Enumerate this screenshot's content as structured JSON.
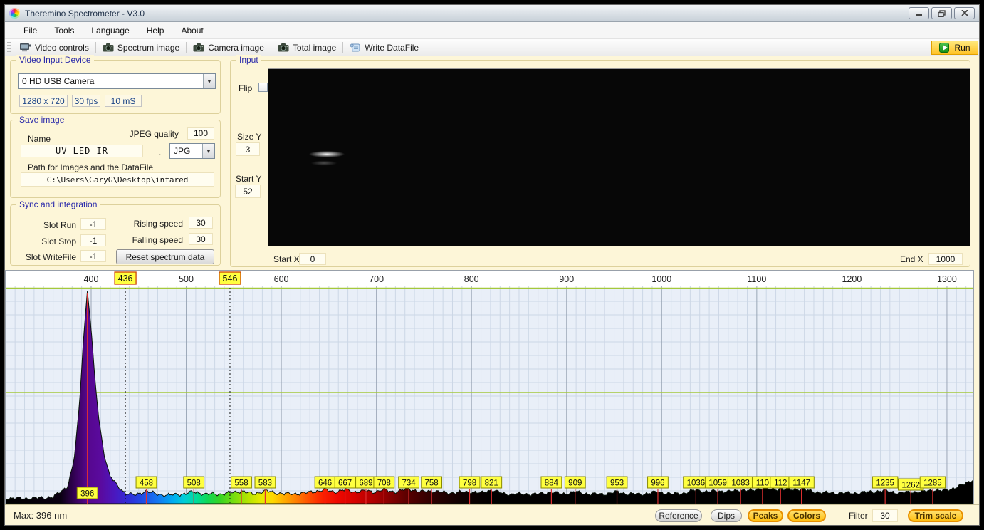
{
  "window": {
    "title": "Theremino Spectrometer - V3.0"
  },
  "menu": {
    "items": [
      "File",
      "Tools",
      "Language",
      "Help",
      "About"
    ]
  },
  "toolbar": {
    "items": [
      {
        "label": "Video controls",
        "icon": "video-controls-icon"
      },
      {
        "label": "Spectrum image",
        "icon": "camera-icon"
      },
      {
        "label": "Camera image",
        "icon": "camera-icon"
      },
      {
        "label": "Total image",
        "icon": "camera-icon"
      },
      {
        "label": "Write DataFile",
        "icon": "scroll-icon"
      }
    ],
    "run_label": "Run"
  },
  "video_input": {
    "group_title": "Video Input Device",
    "device": "0 HD USB Camera",
    "resolution": "1280 x 720",
    "fps": "30 fps",
    "exposure": "10 mS"
  },
  "save_image": {
    "group_title": "Save image",
    "name_label": "Name",
    "jpeg_quality_label": "JPEG quality",
    "jpeg_quality": "100",
    "name_value": "UV LED IR",
    "dot": ".",
    "format": "JPG",
    "path_label": "Path for Images and the DataFile",
    "path": "C:\\Users\\GaryG\\Desktop\\infared"
  },
  "sync": {
    "group_title": "Sync and integration",
    "slot_run_label": "Slot Run",
    "slot_run": "-1",
    "slot_stop_label": "Slot Stop",
    "slot_stop": "-1",
    "slot_writefile_label": "Slot WriteFile",
    "slot_writefile": "-1",
    "rising_label": "Rising speed",
    "rising": "30",
    "falling_label": "Falling speed",
    "falling": "30",
    "reset_button": "Reset spectrum data"
  },
  "input_panel": {
    "group_title": "Input",
    "flip_label": "Flip",
    "size_y_label": "Size Y",
    "size_y": "3",
    "start_y_label": "Start Y",
    "start_y": "52",
    "start_x_label": "Start X",
    "start_x": "0",
    "end_x_label": "End X",
    "end_x": "1000"
  },
  "status_bar": {
    "max_label": "Max: 396 nm",
    "reference": "Reference",
    "dips": "Dips",
    "peaks": "Peaks",
    "colors": "Colors",
    "filter_label": "Filter",
    "filter_value": "30",
    "trim": "Trim scale"
  },
  "colors": {
    "accent_yellow": "#ffd34d",
    "accent_orange_border": "#e08a00",
    "group_title_blue": "#2929aa",
    "run_green": "#1fa01f",
    "peak_line_red": "#e03030",
    "label_yellow": "#ffff40",
    "label_border": "#8a8a00",
    "calibration_border": "#cc4400",
    "grid_minor": "#ccd7e6",
    "grid_major": "#9aa6b6",
    "grid_green": "#a4c83c",
    "chart_bg": "#e9eff8",
    "strip_bg": "#ffffff",
    "curve_stroke": "#0a140a"
  },
  "chart_data": {
    "type": "area",
    "description": "Emission spectrum, intensity vs wavelength (nm)",
    "x_ticks": [
      400,
      500,
      600,
      700,
      800,
      900,
      1000,
      1100,
      1200,
      1300
    ],
    "x_range_nm": [
      309,
      1334
    ],
    "grid": true,
    "calibration_lines_nm": [
      436,
      546
    ],
    "max_peak_nm": 396,
    "peaks": [
      {
        "label": "396",
        "nm": 396,
        "tall_line": true,
        "dy": 15
      },
      {
        "label": "458",
        "nm": 458
      },
      {
        "label": "508",
        "nm": 508
      },
      {
        "label": "558",
        "nm": 558
      },
      {
        "label": "583",
        "nm": 583
      },
      {
        "label": "646",
        "nm": 646
      },
      {
        "label": "667",
        "nm": 667
      },
      {
        "label": "689",
        "nm": 689
      },
      {
        "label": "708",
        "nm": 708
      },
      {
        "label": "734",
        "nm": 734
      },
      {
        "label": "758",
        "nm": 758
      },
      {
        "label": "798",
        "nm": 798
      },
      {
        "label": "821",
        "nm": 821
      },
      {
        "label": "884",
        "nm": 884
      },
      {
        "label": "909",
        "nm": 909
      },
      {
        "label": "953",
        "nm": 953
      },
      {
        "label": "996",
        "nm": 996
      },
      {
        "label": "1036",
        "nm": 1036
      },
      {
        "label": "1059",
        "nm": 1059
      },
      {
        "label": "1083",
        "nm": 1083
      },
      {
        "label": "110",
        "nm": 1106
      },
      {
        "label": "112",
        "nm": 1125
      },
      {
        "label": "1147",
        "nm": 1147
      },
      {
        "label": "1235",
        "nm": 1235
      },
      {
        "label": "1262",
        "nm": 1262,
        "dy": 3
      },
      {
        "label": "1285",
        "nm": 1285
      }
    ],
    "profile_nm_intensity": [
      [
        309,
        2.5
      ],
      [
        340,
        2.5
      ],
      [
        360,
        3
      ],
      [
        375,
        8
      ],
      [
        382,
        20
      ],
      [
        388,
        48
      ],
      [
        392,
        78
      ],
      [
        396,
        100
      ],
      [
        400,
        82
      ],
      [
        404,
        58
      ],
      [
        408,
        40
      ],
      [
        414,
        22
      ],
      [
        420,
        13
      ],
      [
        428,
        8
      ],
      [
        436,
        5
      ],
      [
        446,
        4
      ],
      [
        458,
        6
      ],
      [
        468,
        4.5
      ],
      [
        480,
        4
      ],
      [
        495,
        4.5
      ],
      [
        508,
        5.5
      ],
      [
        520,
        4.5
      ],
      [
        535,
        4.5
      ],
      [
        546,
        5
      ],
      [
        558,
        6
      ],
      [
        570,
        4.5
      ],
      [
        583,
        6
      ],
      [
        595,
        5
      ],
      [
        610,
        4.5
      ],
      [
        625,
        5
      ],
      [
        646,
        6.5
      ],
      [
        656,
        5.5
      ],
      [
        667,
        6.5
      ],
      [
        678,
        5.5
      ],
      [
        689,
        6
      ],
      [
        698,
        5.5
      ],
      [
        708,
        6.5
      ],
      [
        720,
        5.5
      ],
      [
        734,
        7
      ],
      [
        746,
        5.5
      ],
      [
        758,
        6
      ],
      [
        775,
        5
      ],
      [
        798,
        5.5
      ],
      [
        810,
        5
      ],
      [
        821,
        6.5
      ],
      [
        835,
        4.5
      ],
      [
        850,
        4.5
      ],
      [
        870,
        4.5
      ],
      [
        884,
        5.5
      ],
      [
        895,
        4.5
      ],
      [
        909,
        5.5
      ],
      [
        925,
        4.5
      ],
      [
        940,
        4.5
      ],
      [
        953,
        5.5
      ],
      [
        965,
        4.5
      ],
      [
        980,
        4.5
      ],
      [
        996,
        5.5
      ],
      [
        1010,
        4.5
      ],
      [
        1025,
        5
      ],
      [
        1036,
        6.5
      ],
      [
        1048,
        5.5
      ],
      [
        1059,
        6
      ],
      [
        1070,
        5.5
      ],
      [
        1083,
        6.5
      ],
      [
        1095,
        6
      ],
      [
        1106,
        7.5
      ],
      [
        1116,
        6.5
      ],
      [
        1125,
        7
      ],
      [
        1136,
        6.5
      ],
      [
        1147,
        7
      ],
      [
        1160,
        5.5
      ],
      [
        1175,
        5
      ],
      [
        1190,
        5
      ],
      [
        1205,
        5
      ],
      [
        1220,
        5.5
      ],
      [
        1235,
        6
      ],
      [
        1250,
        5
      ],
      [
        1262,
        5.5
      ],
      [
        1275,
        5.5
      ],
      [
        1285,
        6.5
      ],
      [
        1295,
        6
      ],
      [
        1305,
        7
      ],
      [
        1318,
        9
      ],
      [
        1330,
        12
      ],
      [
        1334,
        13
      ]
    ],
    "wavelength_colors": [
      [
        309,
        "#000000"
      ],
      [
        368,
        "#0a0012"
      ],
      [
        385,
        "#3a0260"
      ],
      [
        396,
        "#56078e"
      ],
      [
        410,
        "#5a0a9e"
      ],
      [
        425,
        "#4a18c0"
      ],
      [
        440,
        "#2f2fd8"
      ],
      [
        455,
        "#2050e8"
      ],
      [
        470,
        "#1478f2"
      ],
      [
        485,
        "#00aaf2"
      ],
      [
        497,
        "#00ccd8"
      ],
      [
        510,
        "#00dc9a"
      ],
      [
        522,
        "#10d855"
      ],
      [
        535,
        "#38d422"
      ],
      [
        550,
        "#7ade0e"
      ],
      [
        565,
        "#b8e400"
      ],
      [
        578,
        "#e8ea00"
      ],
      [
        590,
        "#ffd800"
      ],
      [
        602,
        "#ffaa00"
      ],
      [
        615,
        "#ff7c00"
      ],
      [
        628,
        "#ff4e00"
      ],
      [
        642,
        "#fb2000"
      ],
      [
        658,
        "#ee0800"
      ],
      [
        675,
        "#d80200"
      ],
      [
        695,
        "#b00000"
      ],
      [
        715,
        "#800000"
      ],
      [
        735,
        "#500000"
      ],
      [
        758,
        "#2c0000"
      ],
      [
        785,
        "#100000"
      ],
      [
        820,
        "#000000"
      ],
      [
        1334,
        "#000000"
      ]
    ]
  }
}
